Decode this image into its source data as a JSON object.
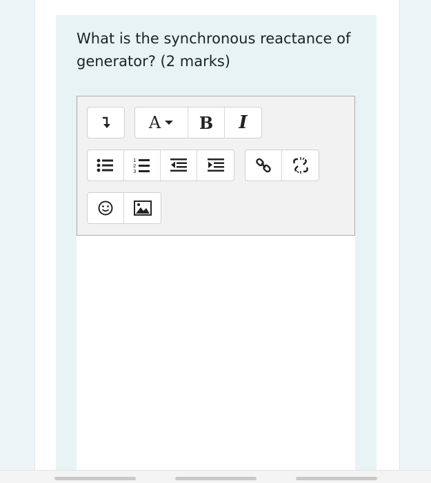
{
  "question": {
    "text": "What is the synchronous reactance of generator? (2 marks)"
  },
  "toolbar": {
    "row1": {
      "collapse_icon": "arrow-down-icon",
      "font_color_label": "A",
      "bold_label": "B",
      "italic_label": "I"
    },
    "row2": {
      "icons": [
        "unordered-list-icon",
        "ordered-list-icon",
        "outdent-icon",
        "indent-icon",
        "link-icon",
        "unlink-icon"
      ]
    },
    "row3": {
      "icons": [
        "emoji-icon",
        "image-icon"
      ]
    }
  },
  "editor": {
    "content": ""
  },
  "colors": {
    "panel": "#e7f3f5",
    "toolbar": "#f2f2f2",
    "text": "#1d2125"
  }
}
